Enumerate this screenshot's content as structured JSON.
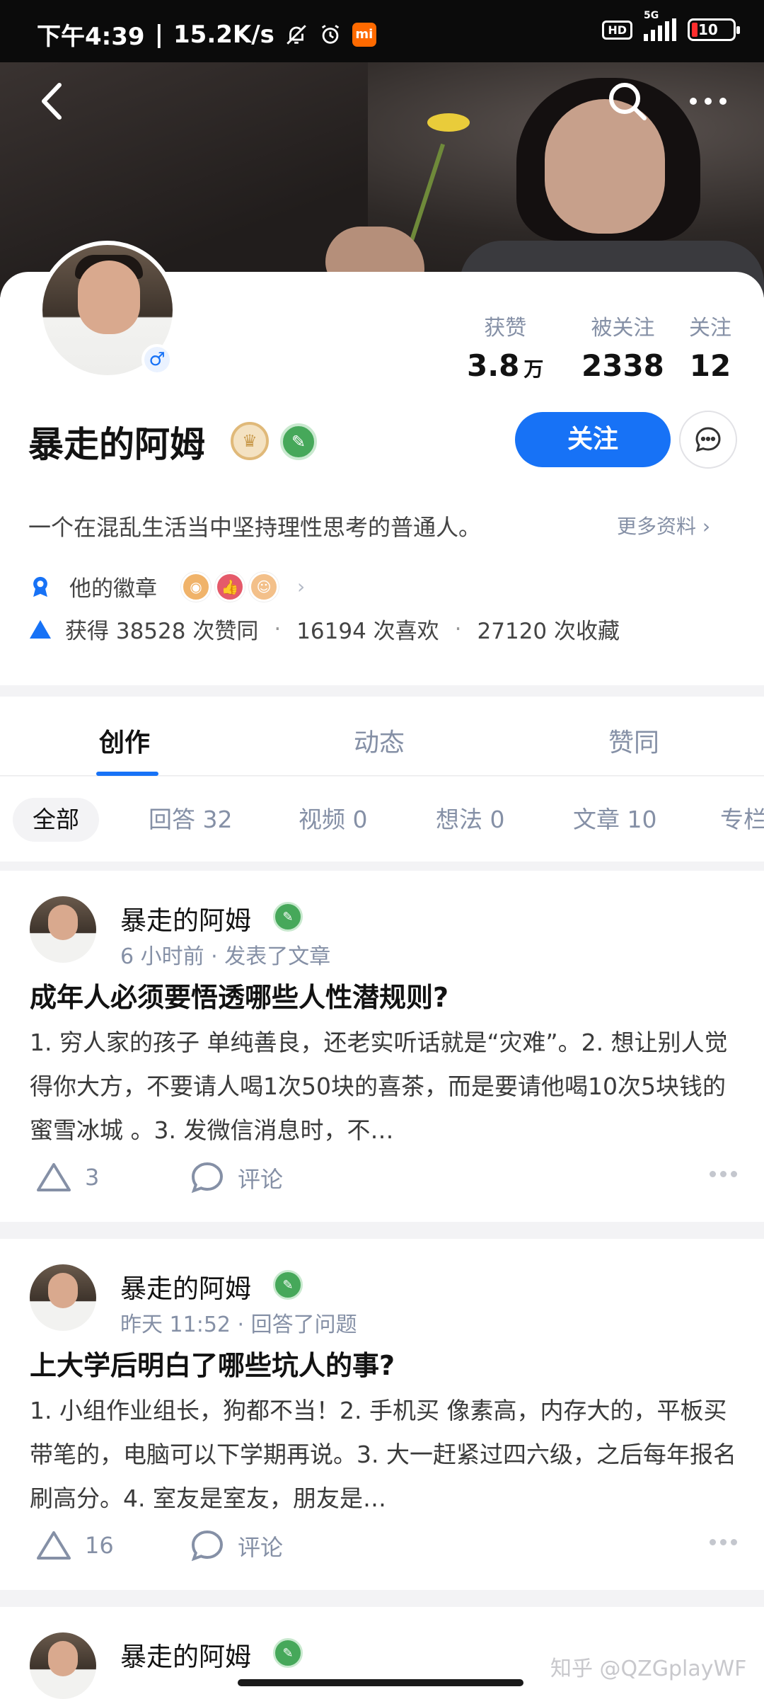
{
  "status_bar": {
    "time": "下午4:39",
    "net_speed": "15.2K/s",
    "hd": "HD",
    "network": "5G",
    "battery": "10",
    "icons": [
      "mute-bell-icon",
      "alarm-icon",
      "mi-app-icon",
      "signal-icon",
      "battery-icon"
    ]
  },
  "header": {
    "icons": [
      "back-icon",
      "search-icon",
      "more-icon"
    ]
  },
  "profile": {
    "name": "暴走的阿姆",
    "gender_icon": "male-icon",
    "stats": [
      {
        "label": "获赞",
        "value": "3.8",
        "unit": "万"
      },
      {
        "label": "被关注",
        "value": "2338"
      },
      {
        "label": "关注",
        "value": "12"
      }
    ],
    "follow_label": "关注",
    "bio": "一个在混乱生活当中坚持理性思考的普通人。",
    "more_info": "更多资料 ›",
    "badges_label": "他的徽章",
    "agree_prefix": "获得 38528 次赞同",
    "like_text": "16194 次喜欢",
    "fav_text": "27120 次收藏",
    "dot": "·"
  },
  "tabs": [
    "创作",
    "动态",
    "赞同"
  ],
  "filters": [
    "全部",
    "回答 32",
    "视频 0",
    "想法 0",
    "文章 10",
    "专栏"
  ],
  "feed": [
    {
      "author": "暴走的阿姆",
      "time": "6 小时前",
      "action": "发表了文章",
      "title": "成年人必须要悟透哪些人性潜规则?",
      "excerpt": "1. 穷人家的孩子 单纯善良，还老实听话就是“灾难”。2. 想让别人觉得你大方，不要请人喝1次50块的喜茶，而是要请他喝10次5块钱的蜜雪冰城 。3. 发微信消息时，不…",
      "votes": "3",
      "comment": "评论"
    },
    {
      "author": "暴走的阿姆",
      "time": "昨天 11:52",
      "action": "回答了问题",
      "title": "上大学后明白了哪些坑人的事?",
      "excerpt": "1. 小组作业组长，狗都不当！2. 手机买 像素高，内存大的，平板买带笔的，电脑可以下学期再说。3. 大一赶紧过四六级，之后每年报名刷高分。4. 室友是室友，朋友是…",
      "votes": "16",
      "comment": "评论"
    },
    {
      "author": "暴走的阿姆"
    }
  ],
  "watermark": "知乎 @QZGplayWF",
  "colors": {
    "accent": "#1772f6",
    "muted": "#8590a6",
    "badge_green": "#46a85a"
  }
}
